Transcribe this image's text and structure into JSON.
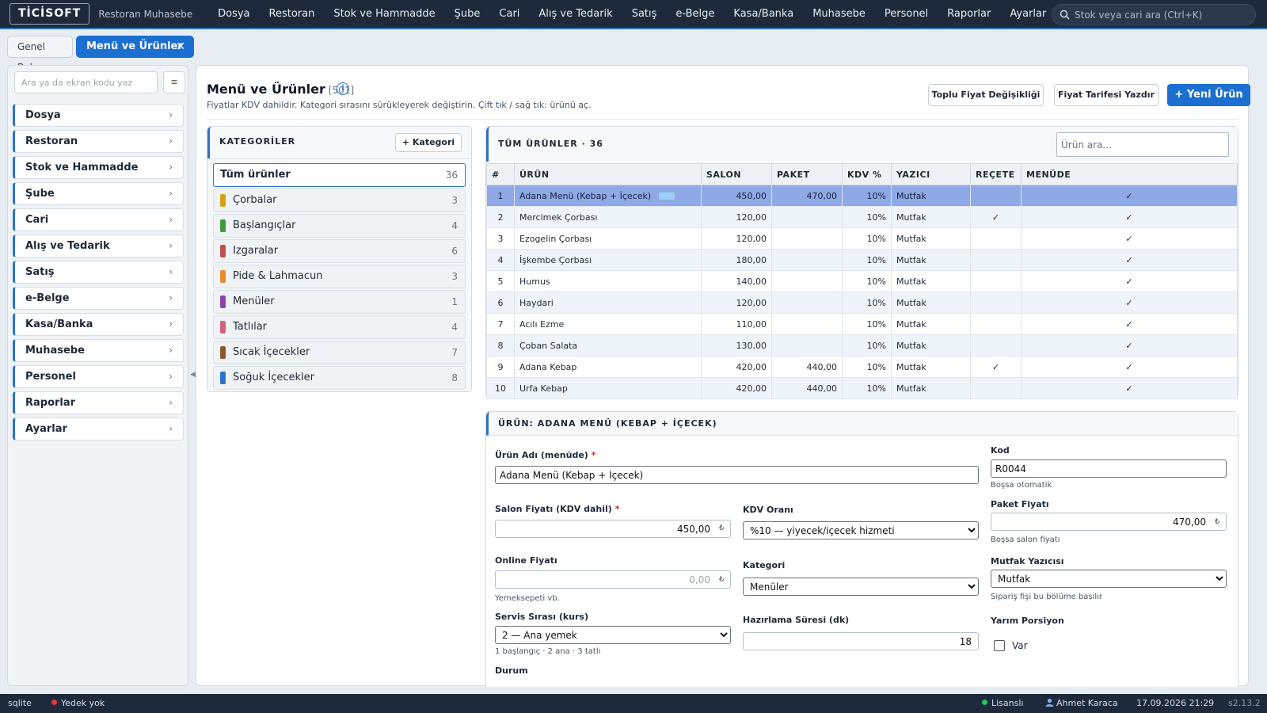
{
  "app": {
    "logo": "TİCİSOFT",
    "subtitle": "Restoran Muhasebe"
  },
  "topmenu": [
    "Dosya",
    "Restoran",
    "Stok ve Hammadde",
    "Şube",
    "Cari",
    "Alış ve Tedarik",
    "Satış",
    "e-Belge",
    "Kasa/Banka",
    "Muhasebe",
    "Personel",
    "Raporlar",
    "Ayarlar"
  ],
  "search": {
    "placeholder": "Stok veya cari ara (Ctrl+K)"
  },
  "tabs": [
    {
      "label": "Genel Bakış"
    },
    {
      "label": "Menü ve Ürünler",
      "close": "✕"
    }
  ],
  "sidebar": {
    "search_placeholder": "Ara ya da ekran kodu yaz",
    "button_icon": "≡",
    "items": [
      "Dosya",
      "Restoran",
      "Stok ve Hammadde",
      "Şube",
      "Cari",
      "Alış ve Tedarik",
      "Satış",
      "e-Belge",
      "Kasa/Banka",
      "Muhasebe",
      "Personel",
      "Raporlar",
      "Ayarlar"
    ]
  },
  "page": {
    "title": "Menü ve Ürünler",
    "code": "[501]",
    "info_icon": "i",
    "subtitle": "Fiyatlar KDV dahildir. Kategori sırasını sürükleyerek değiştirin. Çift tık / sağ tık: ürünü aç.",
    "buttons": {
      "bulk_price": "Toplu Fiyat Değişikliği",
      "print_tariff": "Fiyat Tarifesi Yazdır",
      "new_product": "+ Yeni Ürün"
    }
  },
  "categories": {
    "header": "KATEGORİLER",
    "add_button": "+ Kategori",
    "items": [
      {
        "name": "Tüm ürünler",
        "count": "36",
        "color": ""
      },
      {
        "name": "Çorbalar",
        "count": "3",
        "color": "#d4a017"
      },
      {
        "name": "Başlangıçlar",
        "count": "4",
        "color": "#3f9a3f"
      },
      {
        "name": "Izgaralar",
        "count": "6",
        "color": "#c0504d"
      },
      {
        "name": "Pide & Lahmacun",
        "count": "3",
        "color": "#e8892b"
      },
      {
        "name": "Menüler",
        "count": "1",
        "color": "#8e44ad"
      },
      {
        "name": "Tatlılar",
        "count": "4",
        "color": "#d8607f"
      },
      {
        "name": "Sıcak İçecekler",
        "count": "7",
        "color": "#8b5a2b"
      },
      {
        "name": "Soğuk İçecekler",
        "count": "8",
        "color": "#2f72c9"
      }
    ]
  },
  "products": {
    "header": "TÜM ÜRÜNLER · 36",
    "search_placeholder": "Ürün ara...",
    "columns": [
      "#",
      "ÜRÜN",
      "SALON",
      "PAKET",
      "KDV %",
      "YAZICI",
      "REÇETE",
      "MENÜDE"
    ],
    "rows": [
      {
        "no": "1",
        "name": "Adana Menü (Kebap + İçecek)",
        "tag": "set",
        "salon": "450,00",
        "paket": "470,00",
        "kdv": "10%",
        "printer": "Mutfak",
        "recipe": "",
        "menu": "✓",
        "selected": true
      },
      {
        "no": "2",
        "name": "Mercimek Çorbası",
        "salon": "120,00",
        "paket": "",
        "kdv": "10%",
        "printer": "Mutfak",
        "recipe": "✓",
        "menu": "✓"
      },
      {
        "no": "3",
        "name": "Ezogelin Çorbası",
        "salon": "120,00",
        "paket": "",
        "kdv": "10%",
        "printer": "Mutfak",
        "recipe": "",
        "menu": "✓"
      },
      {
        "no": "4",
        "name": "İşkembe Çorbası",
        "salon": "180,00",
        "paket": "",
        "kdv": "10%",
        "printer": "Mutfak",
        "recipe": "",
        "menu": "✓"
      },
      {
        "no": "5",
        "name": "Humus",
        "salon": "140,00",
        "paket": "",
        "kdv": "10%",
        "printer": "Mutfak",
        "recipe": "",
        "menu": "✓"
      },
      {
        "no": "6",
        "name": "Haydari",
        "salon": "120,00",
        "paket": "",
        "kdv": "10%",
        "printer": "Mutfak",
        "recipe": "",
        "menu": "✓"
      },
      {
        "no": "7",
        "name": "Acılı Ezme",
        "salon": "110,00",
        "paket": "",
        "kdv": "10%",
        "printer": "Mutfak",
        "recipe": "",
        "menu": "✓"
      },
      {
        "no": "8",
        "name": "Çoban Salata",
        "salon": "130,00",
        "paket": "",
        "kdv": "10%",
        "printer": "Mutfak",
        "recipe": "",
        "menu": "✓"
      },
      {
        "no": "9",
        "name": "Adana Kebap",
        "salon": "420,00",
        "paket": "440,00",
        "kdv": "10%",
        "printer": "Mutfak",
        "recipe": "✓",
        "menu": "✓"
      },
      {
        "no": "10",
        "name": "Urfa Kebap",
        "salon": "420,00",
        "paket": "440,00",
        "kdv": "10%",
        "printer": "Mutfak",
        "recipe": "",
        "menu": "✓"
      }
    ]
  },
  "detail": {
    "header": "ÜRÜN: ADANA MENÜ (KEBAP + İÇECEK)",
    "name_label": "Ürün Adı (menüde)",
    "required_mark": "*",
    "name_value": "Adana Menü (Kebap + İçecek)",
    "code_label": "Kod",
    "code_value": "R0044",
    "code_hint": "Boşsa otomatik",
    "salon_label": "Salon Fiyatı (KDV dahil)",
    "salon_value": "450,00",
    "currency": "₺",
    "kdv_label": "KDV Oranı",
    "kdv_value": "%10 — yiyecek/içecek hizmeti",
    "paket_label": "Paket Fiyatı",
    "paket_value": "470,00",
    "paket_hint": "Boşsa salon fiyatı",
    "online_label": "Online Fiyatı",
    "online_value": "0,00",
    "online_hint": "Yemeksepeti vb.",
    "category_label": "Kategori",
    "category_value": "Menüler",
    "printer_label": "Mutfak Yazıcısı",
    "printer_value": "Mutfak",
    "printer_hint": "Sipariş fişi bu bölüme basılır",
    "course_label": "Servis Sırası (kurs)",
    "course_value": "2 — Ana yemek",
    "course_hint": "1 başlangıç · 2 ana · 3 tatlı",
    "prep_label": "Hazırlama Süresi (dk)",
    "prep_value": "18",
    "half_label": "Yarım Porsiyon",
    "half_option": "Var",
    "status_label": "Durum"
  },
  "status": {
    "db": "sqlite",
    "backup": "Yedek yok",
    "license": "Lisanslı",
    "user": "Ahmet Karaca",
    "datetime": "17.09.2026 21:29",
    "version": "s2.13.2"
  }
}
